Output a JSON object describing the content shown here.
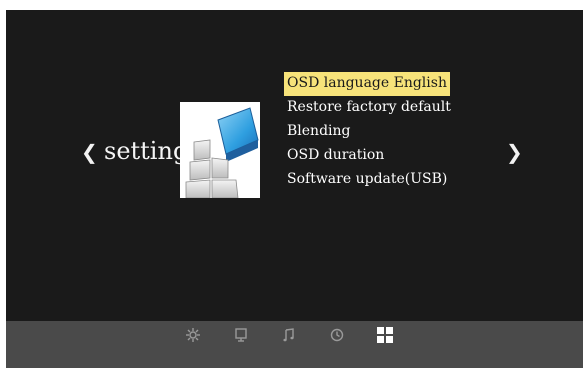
{
  "header": {
    "left_arrow": "❮",
    "right_arrow": "❯",
    "section_title": "setting"
  },
  "menu": {
    "items": [
      {
        "label": "OSD language English",
        "selected": true
      },
      {
        "label": "Restore factory default",
        "selected": false
      },
      {
        "label": "Blending",
        "selected": false
      },
      {
        "label": "OSD duration",
        "selected": false
      },
      {
        "label": "Software update(USB)",
        "selected": false
      }
    ],
    "highlight_color": "#f7e37a"
  },
  "image": {
    "icon": "settings-graphic-icon"
  },
  "bottom_bar": {
    "icons": [
      {
        "name": "picture-settings-icon",
        "active": false
      },
      {
        "name": "display-icon",
        "active": false
      },
      {
        "name": "music-note-icon",
        "active": false
      },
      {
        "name": "clock-icon",
        "active": false
      },
      {
        "name": "settings-grid-icon",
        "active": true
      }
    ]
  },
  "colors": {
    "background": "#1a1a1a",
    "bar": "#4a4a4a",
    "text": "#ffffff",
    "inactive_icon": "#9a9a9a",
    "active_icon": "#ffffff"
  }
}
